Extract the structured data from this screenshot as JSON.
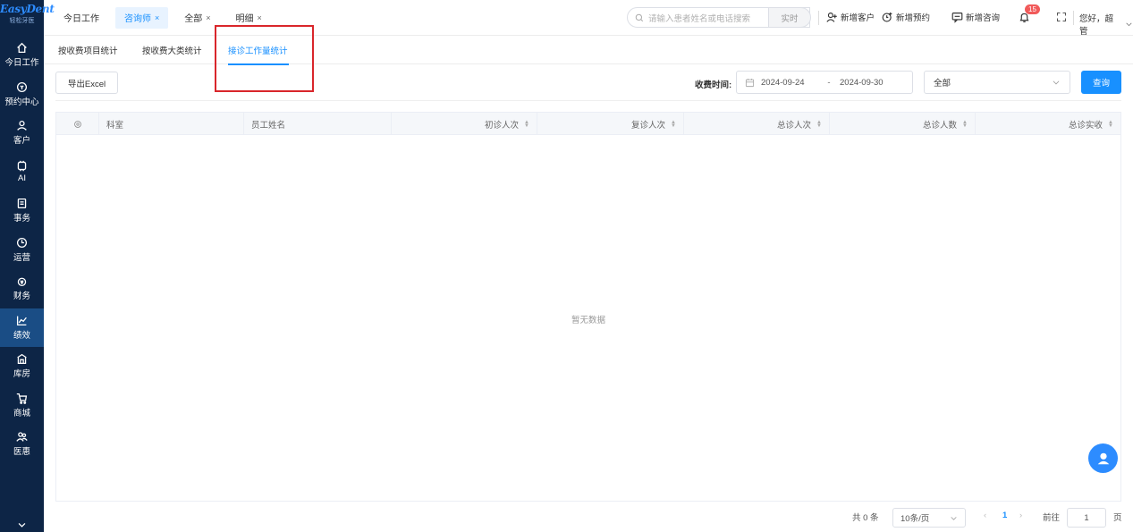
{
  "app": {
    "brand": "EasyDent",
    "brand_sub": "轻松牙医"
  },
  "sidebar": {
    "items": [
      {
        "label": "今日工作",
        "icon": "home-icon"
      },
      {
        "label": "预约中心",
        "icon": "calendar-icon"
      },
      {
        "label": "客户",
        "icon": "user-icon"
      },
      {
        "label": "AI",
        "icon": "ai-icon"
      },
      {
        "label": "事务",
        "icon": "task-icon"
      },
      {
        "label": "运营",
        "icon": "clock-icon"
      },
      {
        "label": "财务",
        "icon": "money-icon"
      },
      {
        "label": "绩效",
        "icon": "chart-icon",
        "active": true
      },
      {
        "label": "库房",
        "icon": "warehouse-icon"
      },
      {
        "label": "商城",
        "icon": "cart-icon"
      },
      {
        "label": "医惠",
        "icon": "users-icon"
      }
    ]
  },
  "tabs": [
    {
      "label": "今日工作",
      "closable": false
    },
    {
      "label": "咨询师",
      "closable": true,
      "active": true
    },
    {
      "label": "全部",
      "closable": true
    },
    {
      "label": "明细",
      "closable": true
    }
  ],
  "close_glyph": "×",
  "header": {
    "search_placeholder": "请输入患者姓名或电话搜索",
    "realtime": "实时",
    "new_customer": "新增客户",
    "new_appointment": "新增预约",
    "new_consult": "新增咨询",
    "notifications": "15",
    "greeting": "您好，超管"
  },
  "subtabs": [
    {
      "label": "按收费项目统计"
    },
    {
      "label": "按收费大类统计"
    },
    {
      "label": "接诊工作量统计",
      "active": true
    }
  ],
  "toolbar": {
    "export": "导出Excel",
    "date_label": "收费时间:",
    "date_start": "2024-09-24",
    "date_sep": "-",
    "date_end": "2024-09-30",
    "select_value": "全部",
    "query": "查询"
  },
  "table": {
    "columns": [
      {
        "label": "科室",
        "sortable": false
      },
      {
        "label": "员工姓名",
        "sortable": false
      },
      {
        "label": "初诊人次",
        "sortable": true
      },
      {
        "label": "复诊人次",
        "sortable": true
      },
      {
        "label": "总诊人次",
        "sortable": true
      },
      {
        "label": "总诊人数",
        "sortable": true
      },
      {
        "label": "总诊实收",
        "sortable": true
      }
    ],
    "empty_text": "暂无数据",
    "rows": []
  },
  "pagination": {
    "total": "共 0 条",
    "page_size": "10条/页",
    "current_page": "1",
    "goto_label": "前往",
    "goto_value": "1",
    "page_unit": "页"
  },
  "colors": {
    "accent": "#1890ff",
    "sidebar_bg": "#0d2546",
    "highlight": "#d9262b",
    "badge": "#f15a5a"
  }
}
